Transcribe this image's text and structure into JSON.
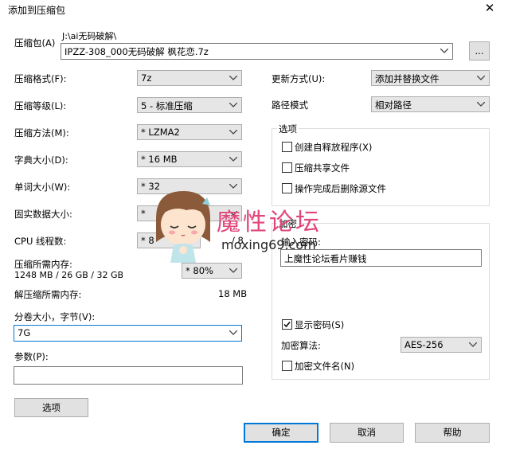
{
  "window": {
    "title": "添加到压缩包",
    "close_glyph": "✕"
  },
  "archive": {
    "label": "压缩包(A)",
    "path": "J:\\ai无码破解\\",
    "filename": "IPZZ-308_000无码破解 枫花恋.7z",
    "browse_label": "..."
  },
  "left": {
    "format_label": "压缩格式(F):",
    "format_value": "7z",
    "level_label": "压缩等级(L):",
    "level_value": "5 - 标准压缩",
    "method_label": "压缩方法(M):",
    "method_value": "* LZMA2",
    "dict_label": "字典大小(D):",
    "dict_value": "* 16 MB",
    "word_label": "单词大小(W):",
    "word_value": "* 32",
    "solid_label": "固实数据大小:",
    "solid_value": "*",
    "cpu_label": "CPU 线程数:",
    "cpu_value": "* 8",
    "cpu_total": "/ 8",
    "mem_label": "压缩所需内存:",
    "mem_detail": "1248 MB / 26 GB / 32 GB",
    "mem_value": "* 80%",
    "dmem_label": "解压缩所需内存:",
    "dmem_value": "18 MB",
    "split_label": "分卷大小，字节(V):",
    "split_value": "7G",
    "params_label": "参数(P):",
    "params_value": "",
    "options_button": "选项"
  },
  "right": {
    "update_label": "更新方式(U):",
    "update_value": "添加并替换文件",
    "path_label": "路径模式",
    "path_value": "相对路径",
    "options_group": "选项",
    "opt_sfx": "创建自释放程序(X)",
    "opt_shared": "压缩共享文件",
    "opt_delete": "操作完成后删除源文件",
    "enc_group": "加密",
    "pwd_label": "输入密码:",
    "pwd_value": "上魔性论坛看片赚钱",
    "show_pwd": "显示密码(S)",
    "enc_method_label": "加密算法:",
    "enc_method_value": "AES-256",
    "enc_names": "加密文件名(N)"
  },
  "buttons": {
    "ok": "确定",
    "cancel": "取消",
    "help": "帮助"
  },
  "watermark": {
    "text": "魔性论坛",
    "url": "moxing69.com"
  }
}
